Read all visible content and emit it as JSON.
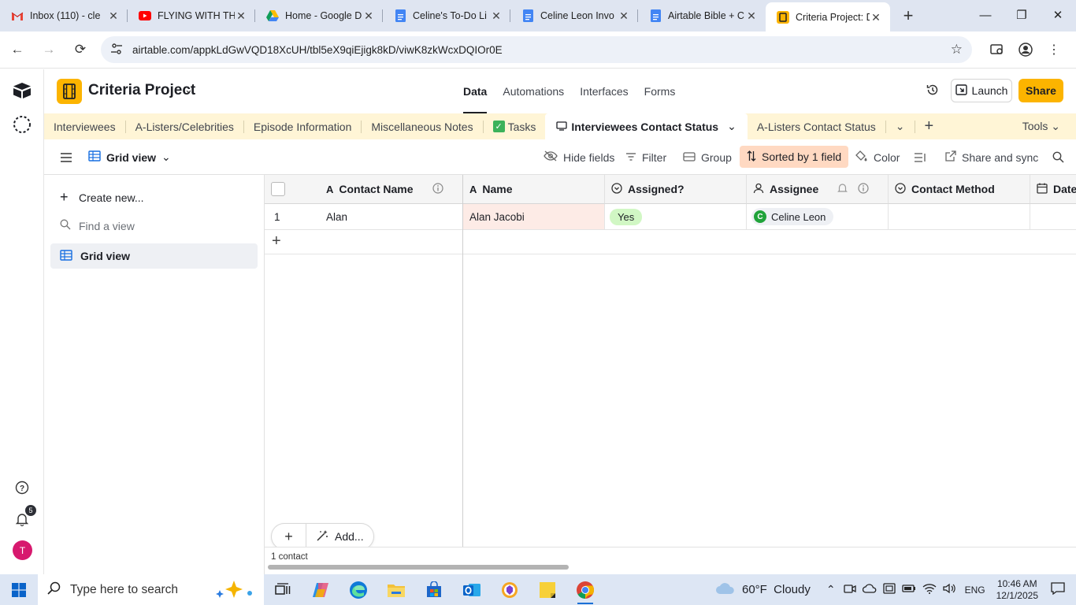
{
  "browser": {
    "tabs": [
      {
        "title": "Inbox (110) - cle",
        "icon": "gmail-icon",
        "active": false
      },
      {
        "title": "FLYING WITH TH",
        "icon": "youtube-icon",
        "active": false
      },
      {
        "title": "Home - Google D",
        "icon": "google-drive-icon",
        "active": false
      },
      {
        "title": "Celine's To-Do Li",
        "icon": "google-docs-icon",
        "active": false
      },
      {
        "title": "Celine Leon Invo",
        "icon": "google-docs-icon",
        "active": false
      },
      {
        "title": "Airtable Bible + C",
        "icon": "google-docs-icon",
        "active": false
      },
      {
        "title": "Criteria Project: D",
        "icon": "airtable-icon",
        "active": true
      }
    ],
    "url": "airtable.com/appkLdGwVQD18XcUH/tbl5eX9qiEjigk8kD/viwK8zkWcxDQIOr0E"
  },
  "base": {
    "name": "Criteria Project",
    "nav": [
      {
        "label": "Data",
        "active": true
      },
      {
        "label": "Automations",
        "active": false
      },
      {
        "label": "Interfaces",
        "active": false
      },
      {
        "label": "Forms",
        "active": false
      }
    ],
    "launch_label": "Launch",
    "share_label": "Share",
    "brand_color": "#fcb400"
  },
  "tables": {
    "items": [
      "Interviewees",
      "A-Listers/Celebrities",
      "Episode Information",
      "Miscellaneous Notes",
      "Tasks",
      "Interviewees Contact Status",
      "A-Listers Contact Status"
    ],
    "tools_label": "Tools"
  },
  "viewbar": {
    "view_name": "Grid view",
    "hide_fields": "Hide fields",
    "filter": "Filter",
    "group": "Group",
    "sorted": "Sorted by 1 field",
    "color": "Color",
    "share_sync": "Share and sync"
  },
  "sidebar": {
    "create_new": "Create new...",
    "find_placeholder": "Find a view",
    "selected_view": "Grid view"
  },
  "grid": {
    "columns": [
      "Contact Name",
      "Name",
      "Assigned?",
      "Assignee",
      "Contact Method",
      "Date"
    ],
    "rows": [
      {
        "num": "1",
        "contact_name": "Alan",
        "name": "Alan Jacobi",
        "assigned": "Yes",
        "assignee": "Celine Leon",
        "assignee_initial": "C",
        "contact_method": ""
      }
    ],
    "add_label": "Add...",
    "record_count": "1 contact"
  },
  "rail": {
    "notifications_count": "5",
    "user_initial": "T"
  },
  "taskbar": {
    "search_placeholder": "Type here to search",
    "weather": "60°F  Cloudy",
    "lang": "ENG",
    "time": "10:46 AM",
    "date": "12/1/2025"
  }
}
